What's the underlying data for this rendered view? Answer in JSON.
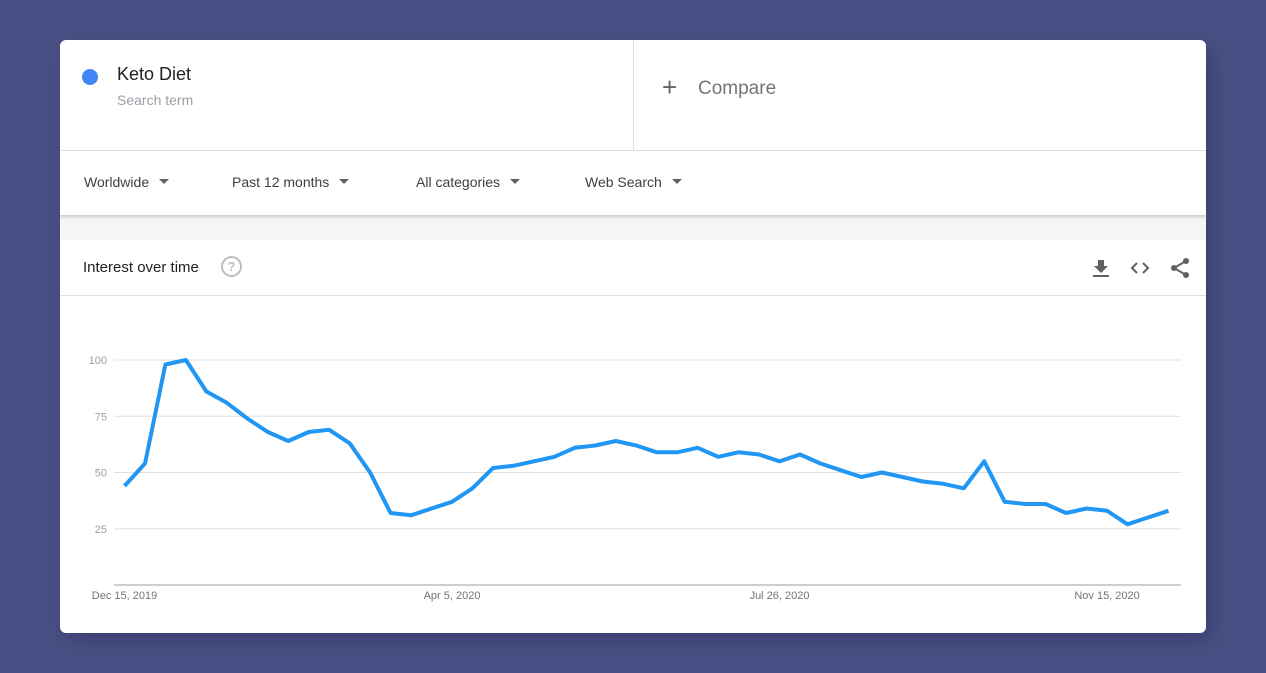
{
  "search_term": {
    "name": "Keto Diet",
    "subtitle": "Search term",
    "color": "#4285f4"
  },
  "compare": {
    "icon": "plus-icon",
    "label": "Compare"
  },
  "filters": [
    {
      "label": "Worldwide"
    },
    {
      "label": "Past 12 months"
    },
    {
      "label": "All categories"
    },
    {
      "label": "Web Search"
    }
  ],
  "panel": {
    "title": "Interest over time",
    "help_icon": "?",
    "tools": [
      "download-icon",
      "embed-code-icon",
      "share-icon"
    ]
  },
  "chart_data": {
    "type": "line",
    "title": "Interest over time",
    "xlabel": "",
    "ylabel": "",
    "ylim": [
      0,
      100
    ],
    "yticks": [
      25,
      50,
      75,
      100
    ],
    "xtick_labels": [
      {
        "label": "Dec 15, 2019",
        "index": 0
      },
      {
        "label": "Apr 5, 2020",
        "index": 16
      },
      {
        "label": "Jul 26, 2020",
        "index": 32
      },
      {
        "label": "Nov 15, 2020",
        "index": 48
      }
    ],
    "grid": true,
    "legend": "none",
    "series": [
      {
        "name": "Keto Diet",
        "color": "#2196f3",
        "values": [
          44,
          54,
          98,
          100,
          86,
          81,
          74,
          68,
          64,
          68,
          69,
          63,
          50,
          32,
          31,
          34,
          37,
          43,
          52,
          53,
          55,
          57,
          61,
          62,
          64,
          62,
          59,
          59,
          61,
          57,
          59,
          58,
          55,
          58,
          54,
          51,
          48,
          50,
          48,
          46,
          45,
          43,
          55,
          37,
          36,
          36,
          32,
          34,
          33,
          27,
          30,
          33
        ]
      }
    ]
  }
}
